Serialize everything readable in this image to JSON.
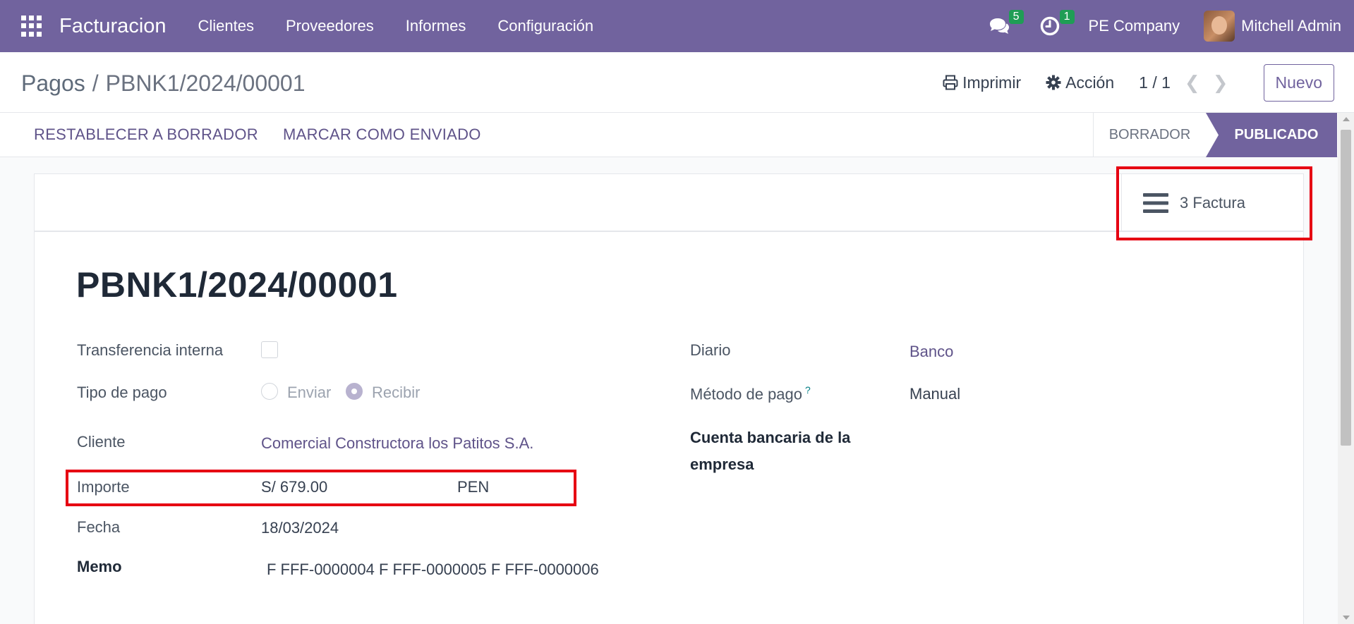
{
  "navbar": {
    "app_name": "Facturacion",
    "menu": [
      "Clientes",
      "Proveedores",
      "Informes",
      "Configuración"
    ],
    "messages_count": "5",
    "activities_count": "1",
    "company": "PE Company",
    "user": "Mitchell Admin"
  },
  "control_panel": {
    "breadcrumb_parent": "Pagos",
    "breadcrumb_current": "PBNK1/2024/00001",
    "print_label": "Imprimir",
    "action_label": "Acción",
    "pager": "1 / 1",
    "new_label": "Nuevo"
  },
  "statusbar": {
    "reset_label": "RESTABLECER A BORRADOR",
    "mark_sent_label": "MARCAR COMO ENVIADO",
    "states": [
      "BORRADOR",
      "PUBLICADO"
    ],
    "active_state": "PUBLICADO"
  },
  "smart_button": {
    "count": "3",
    "label": "Factura",
    "icon": "bars-icon"
  },
  "form": {
    "title": "PBNK1/2024/00001",
    "internal_transfer_label": "Transferencia interna",
    "payment_type_label": "Tipo de pago",
    "payment_type_options": [
      "Enviar",
      "Recibir"
    ],
    "payment_type_value": "Recibir",
    "customer_label": "Cliente",
    "customer_value": "Comercial Constructora los Patitos S.A.",
    "amount_label": "Importe",
    "amount_value": "S/ 679.00",
    "currency_value": "PEN",
    "date_label": "Fecha",
    "date_value": "18/03/2024",
    "memo_label": "Memo",
    "memo_value": "F FFF-0000004 F FFF-0000005 F FFF-0000006",
    "journal_label": "Diario",
    "journal_value": "Banco",
    "payment_method_label": "Método de pago",
    "payment_method_help": "?",
    "payment_method_value": "Manual",
    "company_bank_label": "Cuenta bancaria de la empresa"
  },
  "colors": {
    "brand": "#71639e",
    "highlight": "#e60012",
    "badge": "#1f9d55"
  }
}
